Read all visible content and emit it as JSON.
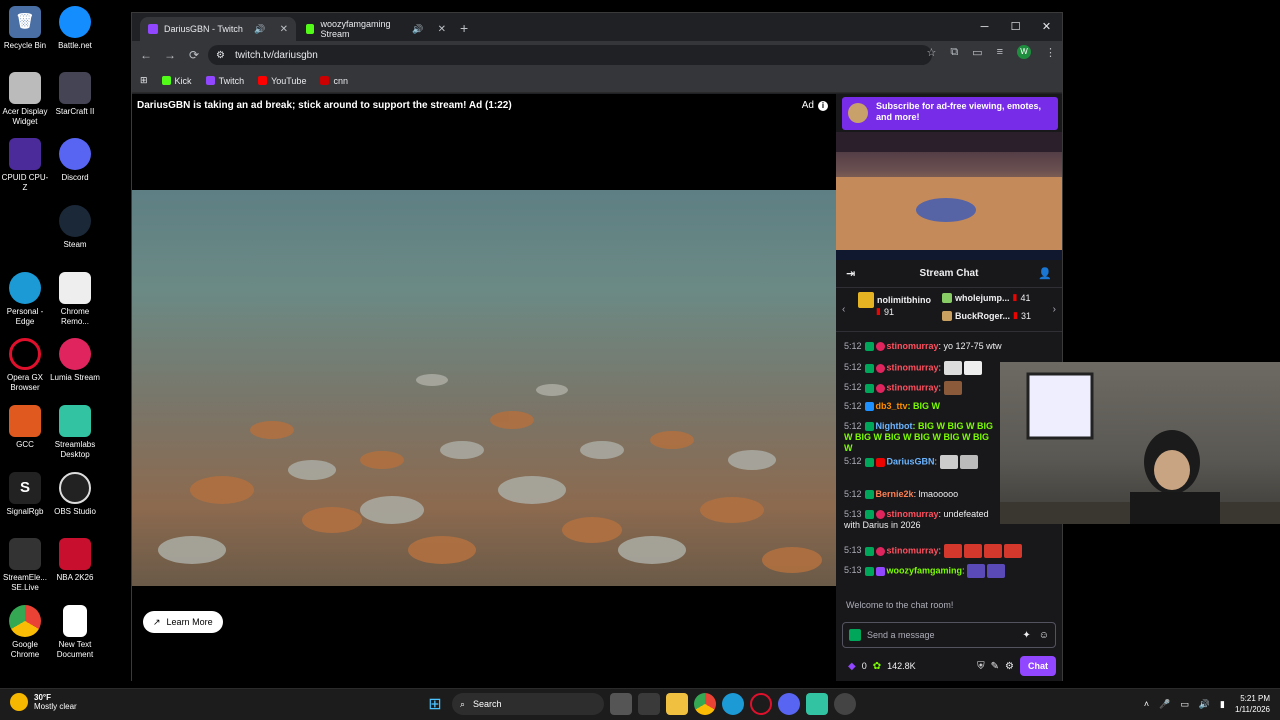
{
  "desktop": {
    "icons": [
      {
        "label": "Recycle Bin"
      },
      {
        "label": "Battle.net"
      },
      {
        "label": "Acer Display Widget"
      },
      {
        "label": "StarCraft II"
      },
      {
        "label": "CPUID CPU-Z"
      },
      {
        "label": "Discord"
      },
      {
        "label": "Steam"
      },
      {
        "label": "Personal - Edge"
      },
      {
        "label": "Chrome Remo..."
      },
      {
        "label": "Opera GX Browser"
      },
      {
        "label": "Lumia Stream"
      },
      {
        "label": "GCC"
      },
      {
        "label": "Streamlabs Desktop"
      },
      {
        "label": "SignalRgb"
      },
      {
        "label": "OBS Studio"
      },
      {
        "label": "StreamEle... SE.Live"
      },
      {
        "label": "NBA 2K26"
      },
      {
        "label": "Google Chrome"
      },
      {
        "label": "New Text Document"
      }
    ]
  },
  "browser": {
    "tabs": [
      {
        "title": "DariusGBN - Twitch"
      },
      {
        "title": "woozyfamgaming Stream"
      }
    ],
    "url": "twitch.tv/dariusgbn",
    "avatar_letter": "W",
    "bookmarks": [
      {
        "label": "Kick",
        "color": "#53fc18"
      },
      {
        "label": "Twitch",
        "color": "#9146ff"
      },
      {
        "label": "YouTube",
        "color": "#ff0000"
      },
      {
        "label": "cnn",
        "color": "#cc0000"
      }
    ]
  },
  "player": {
    "ad_text": "DariusGBN is taking an ad break; stick around to support the stream! Ad (1:22)",
    "ad_badge": "Ad",
    "learn_more": "Learn More"
  },
  "chat": {
    "sub_banner": "Subscribe for ad-free viewing, emotes, and more!",
    "header": "Stream Chat",
    "gifters": [
      {
        "name": "nolimitbhino",
        "count": "91"
      },
      {
        "name": "wholejump...",
        "count": "41"
      },
      {
        "name": "BuckRoger...",
        "count": "31"
      }
    ],
    "messages": [
      {
        "time": "5:12",
        "user": "stinomurray",
        "color": "#ff4f5e",
        "text": ": yo 127-75 wtw"
      },
      {
        "time": "5:12",
        "user": "stinomurray",
        "color": "#ff4f5e",
        "text": ":"
      },
      {
        "time": "5:12",
        "user": "stinomurray",
        "color": "#ff4f5e",
        "text": ":"
      },
      {
        "time": "5:12",
        "user": "db3_ttv",
        "color": "#ff8c00",
        "text": ": BIG W"
      },
      {
        "time": "5:12",
        "user": "Nightbot",
        "color": "#6bb5ff",
        "text": ": BIG W BIG W BIG W BIG W BIG W BIG W BIG W BIG W"
      },
      {
        "time": "5:12",
        "user": "DariusGBN",
        "color": "#6bb5ff",
        "text": ":"
      },
      {
        "time": "5:12",
        "user": "Bernie2k",
        "color": "#ff7f50",
        "text": ": lmaooooo"
      },
      {
        "time": "5:13",
        "user": "stinomurray",
        "color": "#ff4f5e",
        "text": ": undefeated with Darius in 2026"
      },
      {
        "time": "5:13",
        "user": "stinomurray",
        "color": "#ff4f5e",
        "text": ":"
      },
      {
        "time": "5:13",
        "user": "woozyfamgaming",
        "color": "#7cfc00",
        "text": ":"
      }
    ],
    "welcome": "Welcome to the chat room!",
    "input_placeholder": "Send a message",
    "points": "0",
    "channel_points": "142.8K",
    "chat_button": "Chat"
  },
  "taskbar": {
    "temp": "30°F",
    "weather": "Mostly clear",
    "search": "Search",
    "time": "5:21 PM",
    "date": "1/11/2026"
  }
}
